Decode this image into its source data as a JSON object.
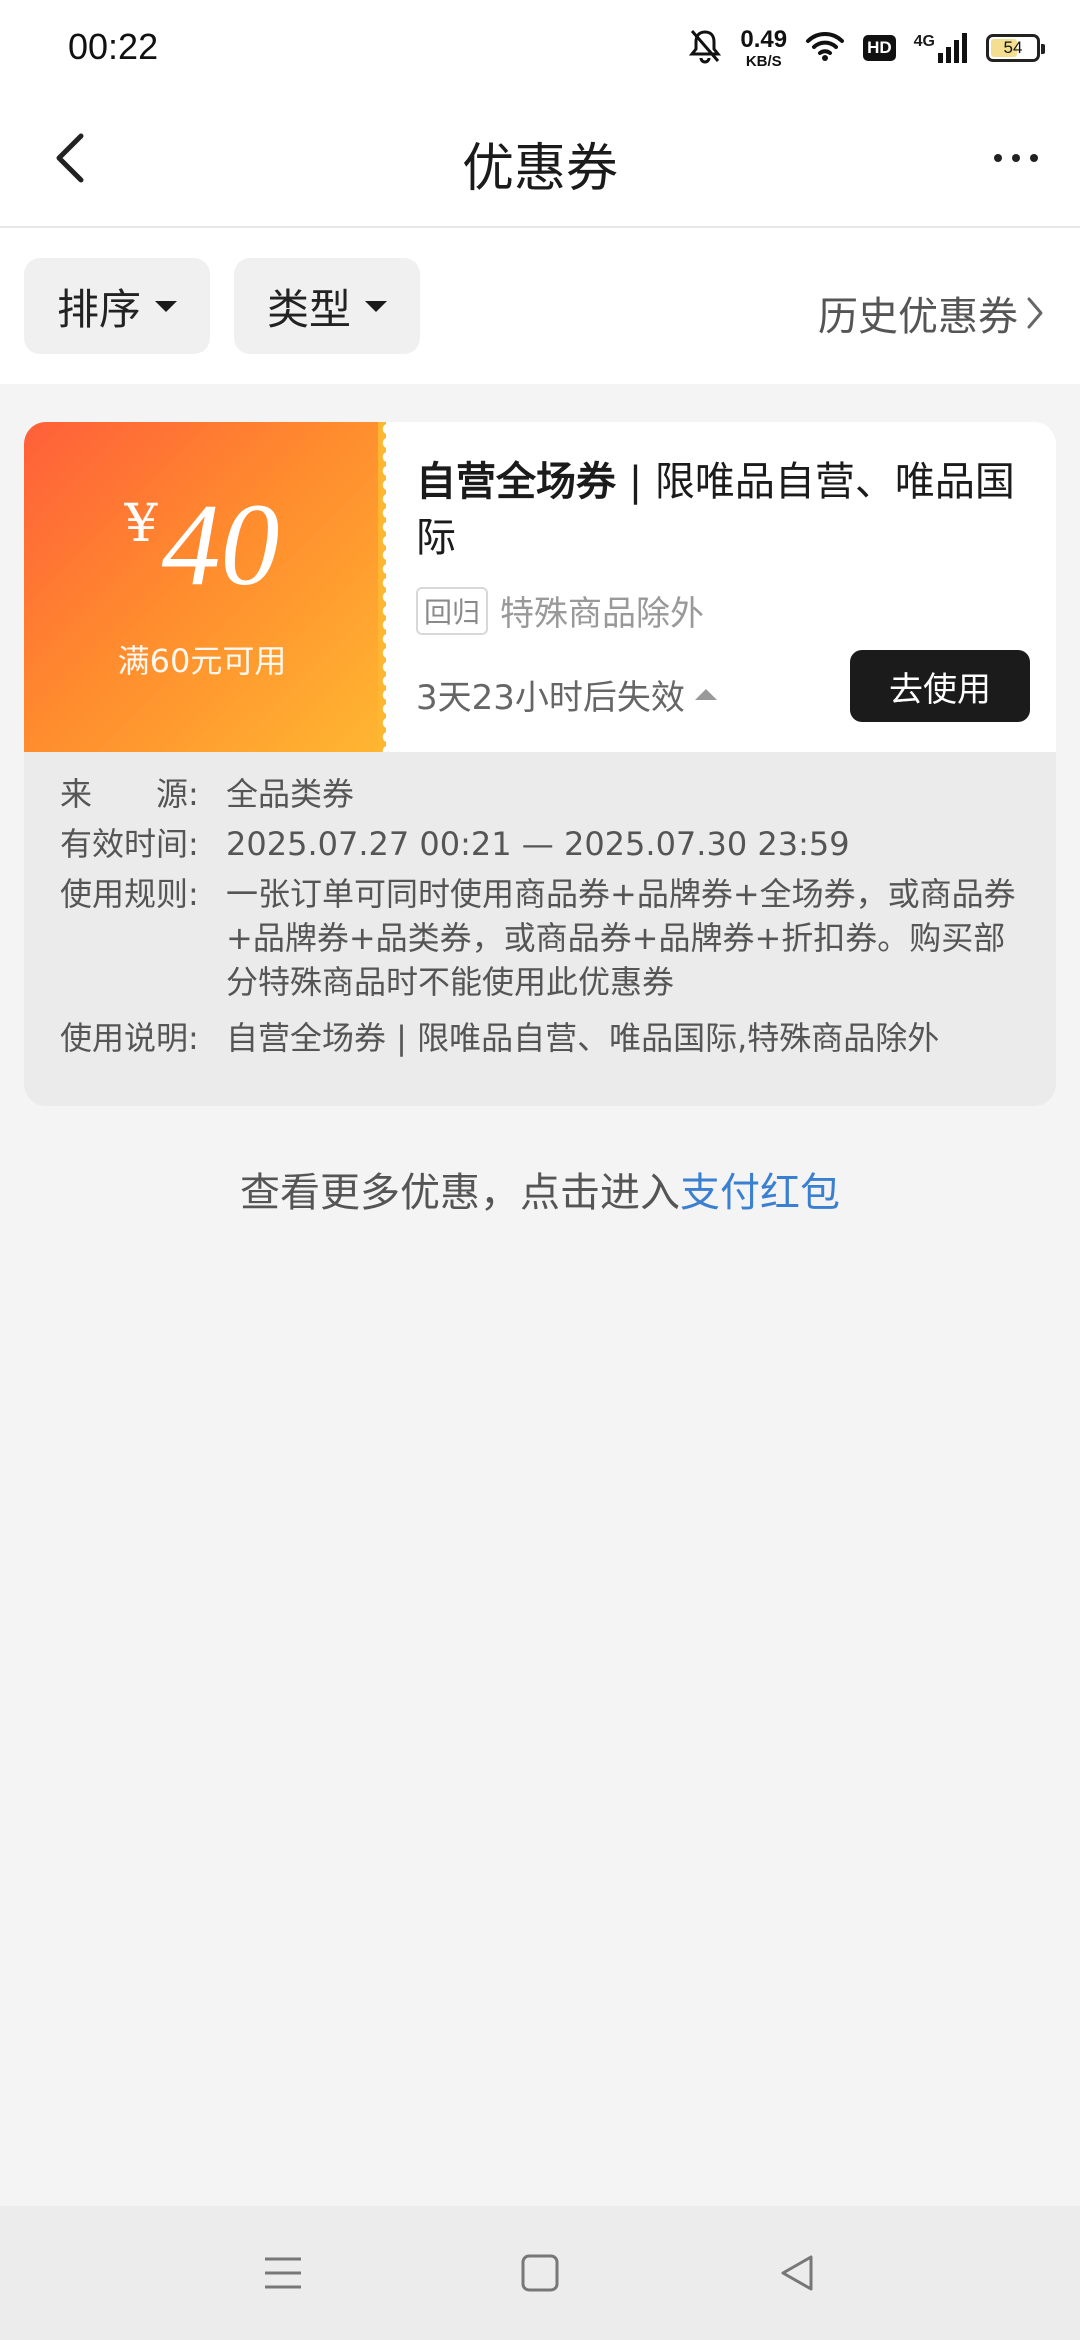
{
  "status_bar": {
    "time": "00:22",
    "net_speed_value": "0.49",
    "net_speed_unit": "KB/S",
    "hd_label": "HD",
    "signal_label": "4G",
    "battery": "54"
  },
  "header": {
    "title": "优惠券",
    "back_icon": "chevron-left-icon",
    "more_icon": "more-dots-icon"
  },
  "filters": {
    "sort_label": "排序",
    "type_label": "类型",
    "history_label": "历史优惠券"
  },
  "coupon": {
    "currency": "¥",
    "amount": "40",
    "condition": "满60元可用",
    "title_bold": "自营全场券",
    "title_rest": " | 限唯品自营、唯品国际",
    "tag": "回归",
    "note": "特殊商品除外",
    "expire": "3天23小时后失效",
    "use_button": "去使用",
    "colors": {
      "gradient_start": "#ff5f3a",
      "gradient_end": "#ffb631",
      "button": "#1b1b1b"
    }
  },
  "details": {
    "source_label": "来　　源:",
    "source_value": "全品类券",
    "valid_label": "有效时间:",
    "valid_value": "2025.07.27 00:21 — 2025.07.30 23:59",
    "rules_label": "使用规则:",
    "rules_value": "一张订单可同时使用商品券+品牌券+全场券，或商品券+品牌券+品类券，或商品券+品牌券+折扣券。购买部分特殊商品时不能使用此优惠券",
    "desc_label": "使用说明:",
    "desc_value": "自营全场券 | 限唯品自营、唯品国际,特殊商品除外"
  },
  "promo": {
    "text": "查看更多优惠，点击进入",
    "link": "支付红包",
    "link_color": "#3a7fd0"
  },
  "system_nav": {
    "menu_icon": "menu-icon",
    "home_icon": "home-square-icon",
    "back_icon": "back-triangle-icon"
  }
}
